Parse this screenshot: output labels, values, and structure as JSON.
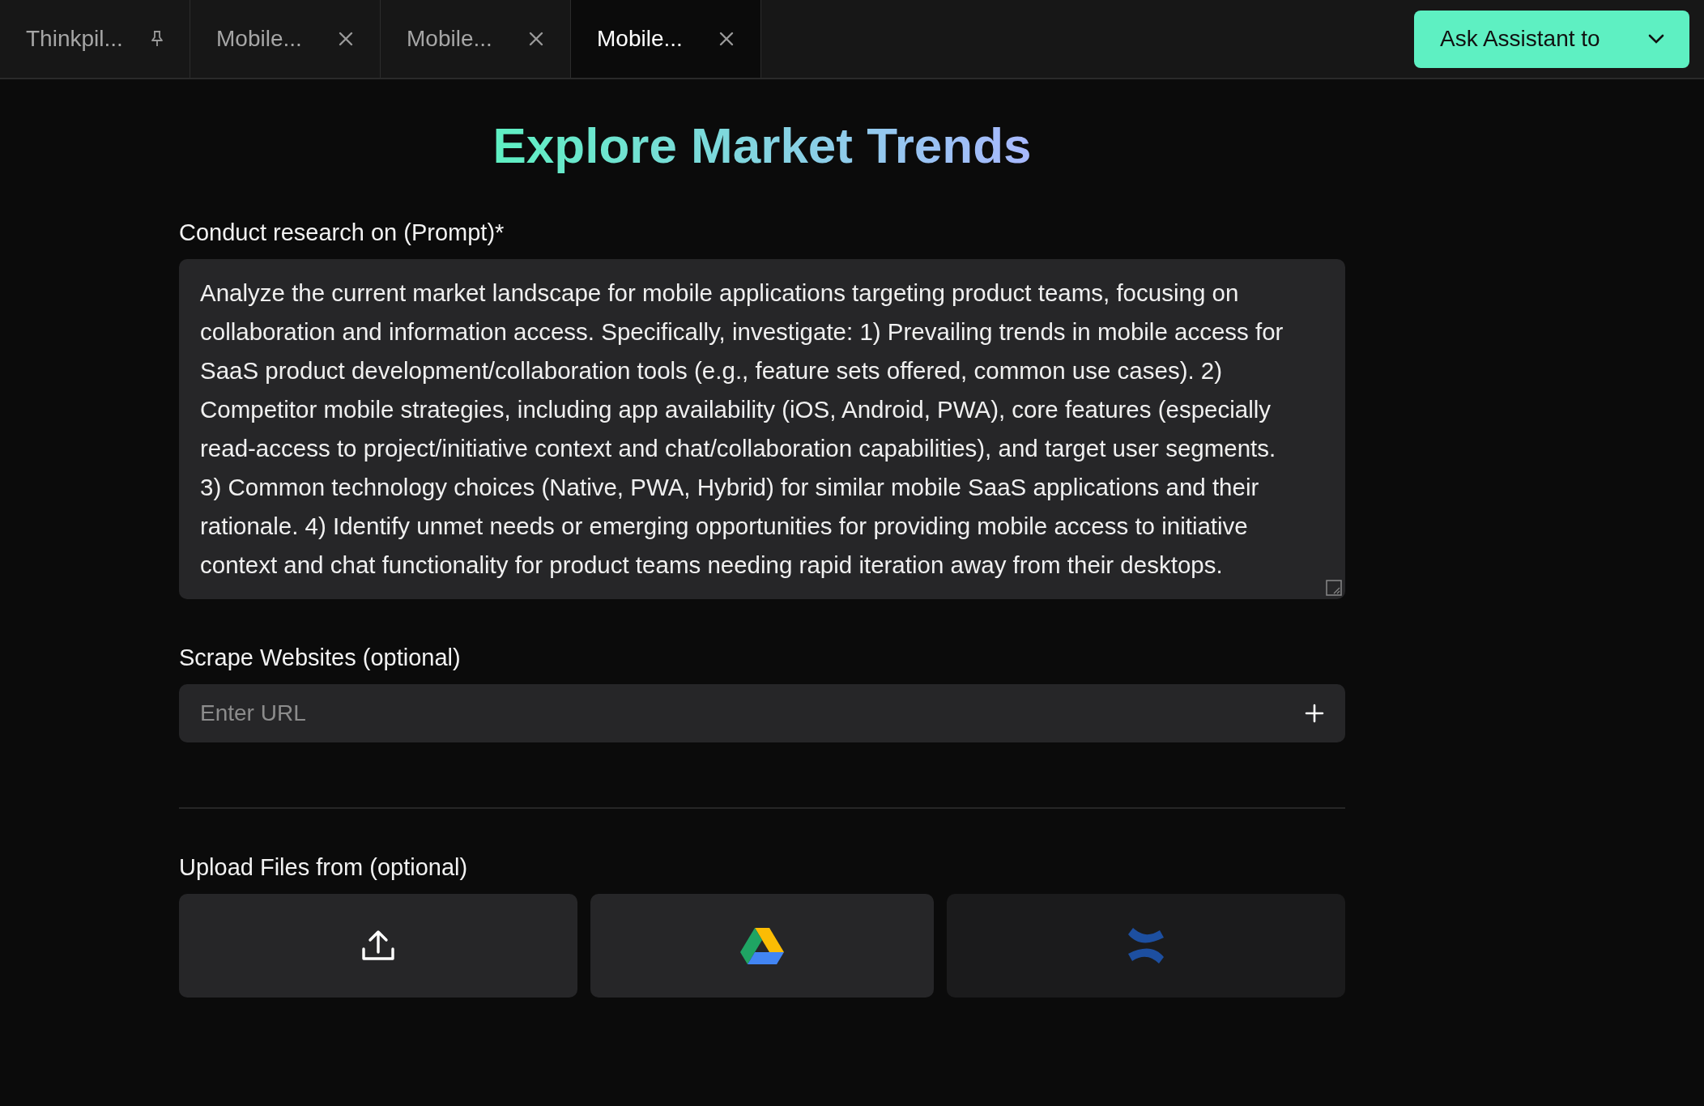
{
  "tabs": [
    {
      "label": "Thinkpil...",
      "pinned": true,
      "closable": false,
      "selected": false
    },
    {
      "label": "Mobile...",
      "pinned": false,
      "closable": true,
      "selected": false
    },
    {
      "label": "Mobile...",
      "pinned": false,
      "closable": true,
      "selected": false
    },
    {
      "label": "Mobile...",
      "pinned": false,
      "closable": true,
      "selected": true
    }
  ],
  "assistant_button": {
    "label": "Ask Assistant to"
  },
  "title": "Explore Market Trends",
  "prompt": {
    "label": "Conduct research on (Prompt)",
    "required_mark": "*",
    "value": "Analyze the current market landscape for mobile applications targeting product teams, focusing on collaboration and information access. Specifically, investigate: 1) Prevailing trends in mobile access for SaaS product development/collaboration tools (e.g., feature sets offered, common use cases). 2) Competitor mobile strategies, including app availability (iOS, Android, PWA), core features (especially read-access to project/initiative context and chat/collaboration capabilities), and target user segments. 3) Common technology choices (Native, PWA, Hybrid) for similar mobile SaaS applications and their rationale. 4) Identify unmet needs or emerging opportunities for providing mobile access to initiative context and chat functionality for product teams needing rapid iteration away from their desktops."
  },
  "scrape": {
    "label": "Scrape Websites (optional)",
    "placeholder": "Enter URL"
  },
  "upload": {
    "label": "Upload Files from (optional)",
    "sources": [
      {
        "kind": "upload",
        "disabled": false
      },
      {
        "kind": "drive",
        "disabled": false
      },
      {
        "kind": "confluence",
        "disabled": true
      }
    ]
  }
}
